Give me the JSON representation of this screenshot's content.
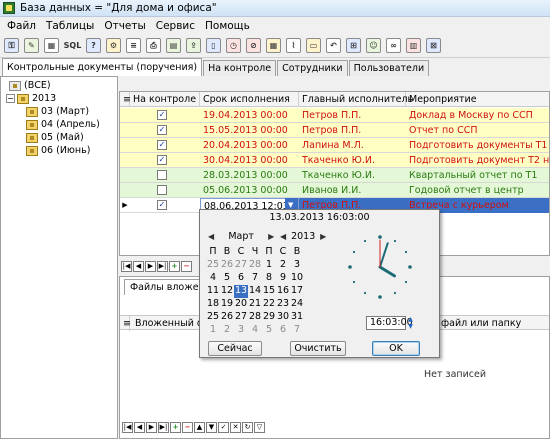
{
  "window": {
    "title": "База данных = \"Для дома и офиса\""
  },
  "menu": [
    "Файл",
    "Таблицы",
    "Отчеты",
    "Сервис",
    "Помощь"
  ],
  "toolbar": {
    "sql_label": "SQL"
  },
  "tabs": [
    "Контрольные документы (поручения)",
    "На контроле",
    "Сотрудники",
    "Пользователи"
  ],
  "tree": {
    "root": "(ВСЕ)",
    "year": "2013",
    "months": [
      "03 (Март)",
      "04 (Апрель)",
      "05 (Май)",
      "06 (Июнь)"
    ]
  },
  "grid": {
    "headers": [
      "На контроле",
      "Срок исполнения",
      "Главный исполнитель",
      "Мероприятие"
    ],
    "rows": [
      {
        "checked": true,
        "date": "19.04.2013 00:00",
        "executor": "Петров П.П.",
        "event": "Доклад в Москву по ССП",
        "bg": "#ffffc4",
        "fg": "#d01010"
      },
      {
        "checked": true,
        "date": "15.05.2013 00:00",
        "executor": "Петров П.П.",
        "event": "Отчет по ССП",
        "bg": "#ffffc4",
        "fg": "#d01010"
      },
      {
        "checked": true,
        "date": "20.04.2013 00:00",
        "executor": "Лапина М.Л.",
        "event": "Подготовить документы Т1",
        "bg": "#ffffc4",
        "fg": "#d01010"
      },
      {
        "checked": true,
        "date": "30.04.2013 00:00",
        "executor": "Ткаченко Ю.И.",
        "event": "Подготовить документ Т2 на выезд",
        "bg": "#ffffc4",
        "fg": "#d01010"
      },
      {
        "checked": false,
        "date": "28.03.2013 00:00",
        "executor": "Ткаченко Ю.И.",
        "event": "Квартальный отчет по Т1",
        "bg": "#e4f8d8",
        "fg": "#2a7a10"
      },
      {
        "checked": false,
        "date": "05.06.2013 00:00",
        "executor": "Иванов И.И.",
        "event": "Годовой отчет в центр",
        "bg": "#e4f8d8",
        "fg": "#2a7a10"
      },
      {
        "checked": true,
        "date": "08.06.2013 12:03:00",
        "executor": "Петров П.П.",
        "event": "Встреча с курьером",
        "bg": "#ffffff",
        "fg": "#d01010",
        "current": true
      }
    ]
  },
  "subpanel": {
    "tab": "Файлы вложений",
    "col1": "Вложенный фай",
    "col2": "файл или папку",
    "empty": "Нет записей"
  },
  "picker": {
    "datetime": "13.03.2013 16:03:00",
    "month": "Март",
    "year": "2013",
    "dayheaders": [
      "П",
      "В",
      "С",
      "Ч",
      "П",
      "С",
      "В"
    ],
    "days": [
      {
        "d": "25",
        "o": true
      },
      {
        "d": "26",
        "o": true
      },
      {
        "d": "27",
        "o": true
      },
      {
        "d": "28",
        "o": true
      },
      {
        "d": "1"
      },
      {
        "d": "2"
      },
      {
        "d": "3"
      },
      {
        "d": "4"
      },
      {
        "d": "5"
      },
      {
        "d": "6"
      },
      {
        "d": "7"
      },
      {
        "d": "8"
      },
      {
        "d": "9"
      },
      {
        "d": "10"
      },
      {
        "d": "11"
      },
      {
        "d": "12"
      },
      {
        "d": "13",
        "s": true
      },
      {
        "d": "14"
      },
      {
        "d": "15"
      },
      {
        "d": "16"
      },
      {
        "d": "17"
      },
      {
        "d": "18"
      },
      {
        "d": "19"
      },
      {
        "d": "20"
      },
      {
        "d": "21"
      },
      {
        "d": "22"
      },
      {
        "d": "23"
      },
      {
        "d": "24"
      },
      {
        "d": "25"
      },
      {
        "d": "26"
      },
      {
        "d": "27"
      },
      {
        "d": "28"
      },
      {
        "d": "29"
      },
      {
        "d": "30"
      },
      {
        "d": "31"
      },
      {
        "d": "1",
        "o": true
      },
      {
        "d": "2",
        "o": true
      },
      {
        "d": "3",
        "o": true
      },
      {
        "d": "4",
        "o": true
      },
      {
        "d": "5",
        "o": true
      },
      {
        "d": "6",
        "o": true
      },
      {
        "d": "7",
        "o": true
      }
    ],
    "time": "16:03:00",
    "today_button": "Сейчас",
    "clear_button": "Очистить",
    "ok_button": "OK"
  }
}
